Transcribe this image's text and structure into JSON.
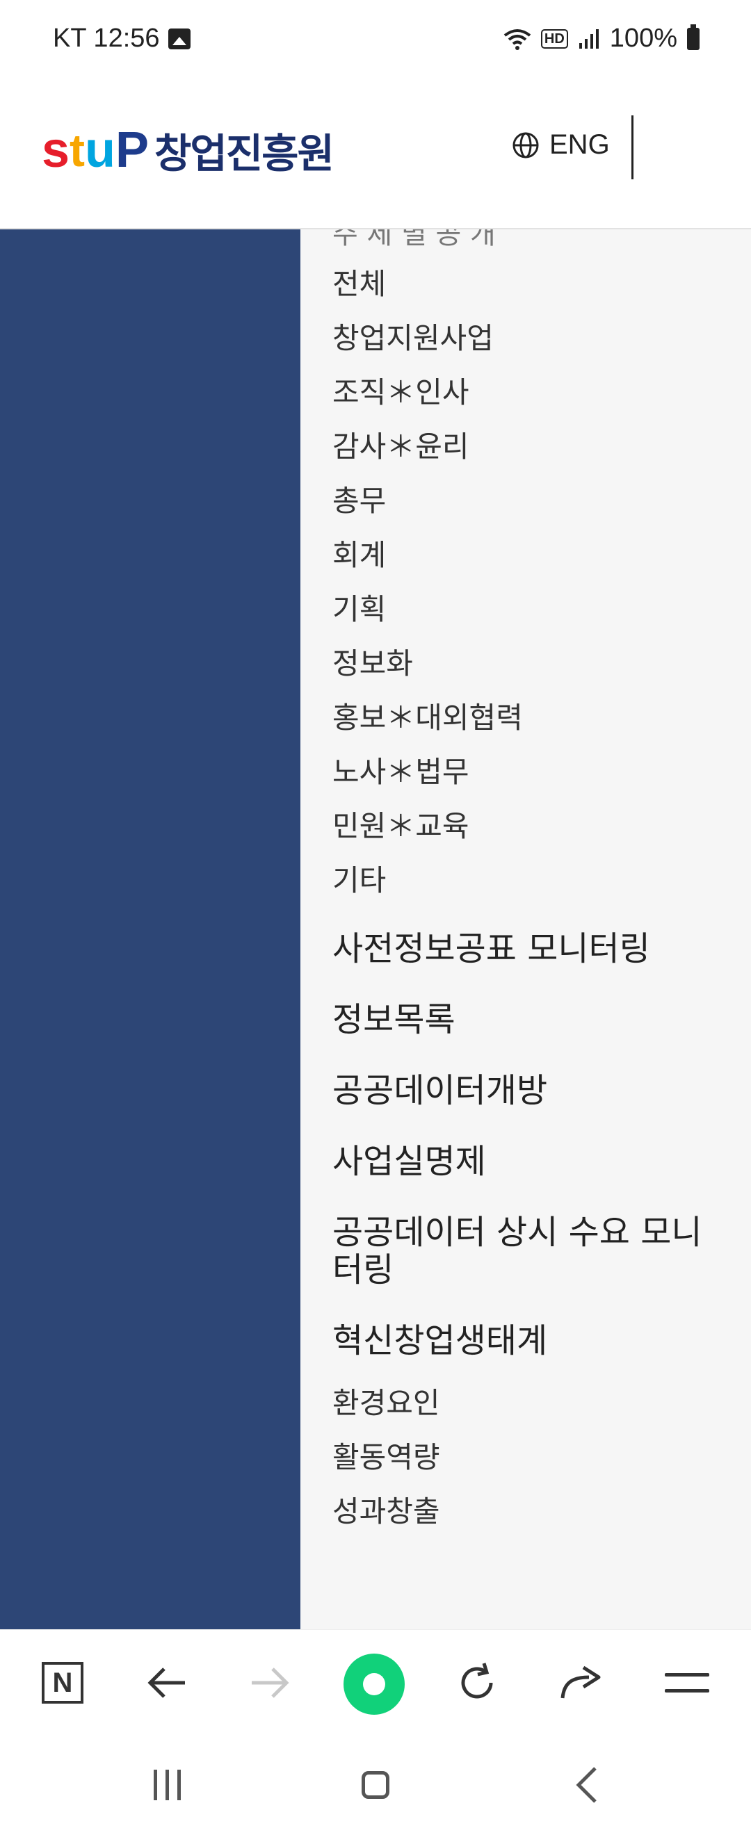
{
  "status_bar": {
    "carrier_time": "KT 12:56",
    "battery": "100%",
    "hd_label": "HD"
  },
  "header": {
    "logo_mark": [
      "s",
      "t",
      "u",
      "P"
    ],
    "logo_text": "창업진흥원",
    "language_label": "ENG"
  },
  "menu": {
    "cut_off_title": "주 제 별 공 개",
    "sub_items": [
      {
        "label": "전체"
      },
      {
        "label": "창업지원사업"
      },
      {
        "label": "조직＊인사"
      },
      {
        "label": "감사＊윤리"
      },
      {
        "label": "총무"
      },
      {
        "label": "회계"
      },
      {
        "label": "기획"
      },
      {
        "label": "정보화"
      },
      {
        "label": "홍보＊대외협력"
      },
      {
        "label": "노사＊법무"
      },
      {
        "label": "민원＊교육"
      },
      {
        "label": "기타"
      }
    ],
    "sections": [
      {
        "label": "사전정보공표 모니터링"
      },
      {
        "label": "정보목록"
      },
      {
        "label": "공공데이터개방"
      },
      {
        "label": "사업실명제"
      },
      {
        "label": "공공데이터 상시 수요 모니터링"
      },
      {
        "label": "혁신창업생태계"
      }
    ],
    "ecosystem_items": [
      {
        "label": "환경요인"
      },
      {
        "label": "활동역량"
      },
      {
        "label": "성과창출"
      }
    ]
  },
  "toolbar": {
    "n_label": "N"
  },
  "colors": {
    "left_panel": "#2d4676",
    "right_panel": "#f6f6f6",
    "green_button": "#11d17a",
    "logo_navy": "#1b2f6b"
  },
  "icons": [
    "image-icon",
    "wifi-icon",
    "hd-icon",
    "signal-icon",
    "battery-icon",
    "globe-icon",
    "n-icon",
    "back-arrow-icon",
    "forward-arrow-icon",
    "green-dot-icon",
    "refresh-icon",
    "share-icon",
    "menu-icon",
    "recents-icon",
    "home-icon",
    "nav-back-icon"
  ]
}
